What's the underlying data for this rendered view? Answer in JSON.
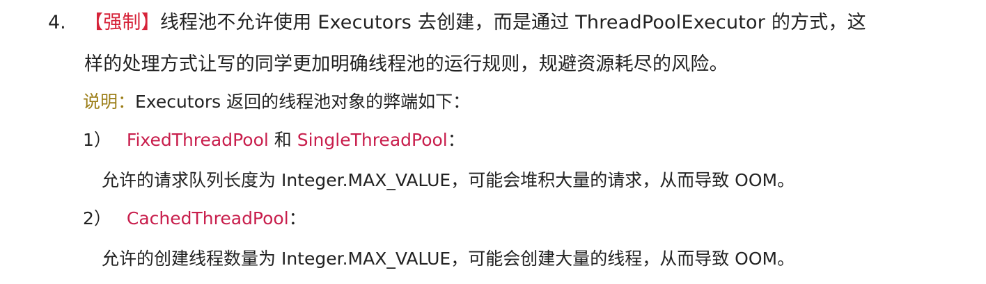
{
  "rule": {
    "number": "4.",
    "tag": "【强制】",
    "text_line1": "线程池不允许使用 Executors 去创建，而是通过 ThreadPoolExecutor 的方式，这",
    "text_line2": "样的处理方式让写的同学更加明确线程池的运行规则，规避资源耗尽的风险。",
    "note_label": "说明：",
    "note_text": "Executors 返回的线程池对象的弊端如下：",
    "items": [
      {
        "index": "1）",
        "class_a": "FixedThreadPool",
        "connector": " 和 ",
        "class_b": "SingleThreadPool",
        "suffix": "：",
        "detail": "允许的请求队列长度为 Integer.MAX_VALUE，可能会堆积大量的请求，从而导致 OOM。"
      },
      {
        "index": "2）",
        "class_a": "CachedThreadPool",
        "suffix": "：",
        "detail": "允许的创建线程数量为 Integer.MAX_VALUE，可能会创建大量的线程，从而导致 OOM。"
      }
    ]
  },
  "colors": {
    "mandatory": "#d6243a",
    "note_label": "#9b7d16",
    "class_name": "#c81e4c",
    "text": "#222222"
  }
}
